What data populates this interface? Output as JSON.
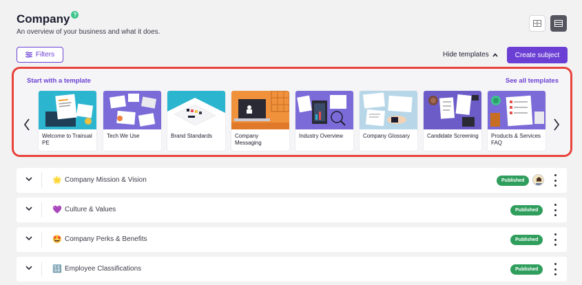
{
  "header": {
    "title": "Company",
    "help_glyph": "?",
    "subtitle": "An overview of your business and what it does."
  },
  "toolbar": {
    "filters_label": "Filters",
    "hide_templates_label": "Hide templates",
    "create_label": "Create subject"
  },
  "templates": {
    "heading": "Start with a template",
    "see_all": "See all templates",
    "cards": [
      {
        "label": "Welcome to Trainual PE"
      },
      {
        "label": "Tech We Use"
      },
      {
        "label": "Brand Standards"
      },
      {
        "label": "Company Messaging"
      },
      {
        "label": "Industry Overview"
      },
      {
        "label": "Company Glossary"
      },
      {
        "label": "Candidate Screening"
      },
      {
        "label": "Products & Services FAQ"
      }
    ]
  },
  "subjects": [
    {
      "emoji": "🌟",
      "name": "Company Mission & Vision",
      "status": "Published",
      "has_avatar": true
    },
    {
      "emoji": "💜",
      "name": "Culture & Values",
      "status": "Published"
    },
    {
      "emoji": "🤩",
      "name": "Company Perks & Benefits",
      "status": "Published"
    },
    {
      "emoji": "🔢",
      "name": "Employee Classifications",
      "status": "Published"
    }
  ],
  "colors": {
    "accent": "#6b3fd4",
    "highlight_border": "#e8423a",
    "published": "#2f9e5c",
    "help": "#3cc48a"
  },
  "icons": [
    "help-icon",
    "grid-view-icon",
    "list-view-icon",
    "filter-icon",
    "chevron-up-icon",
    "chevron-left-icon",
    "chevron-right-icon",
    "chevron-down-icon",
    "kebab-menu-icon"
  ]
}
